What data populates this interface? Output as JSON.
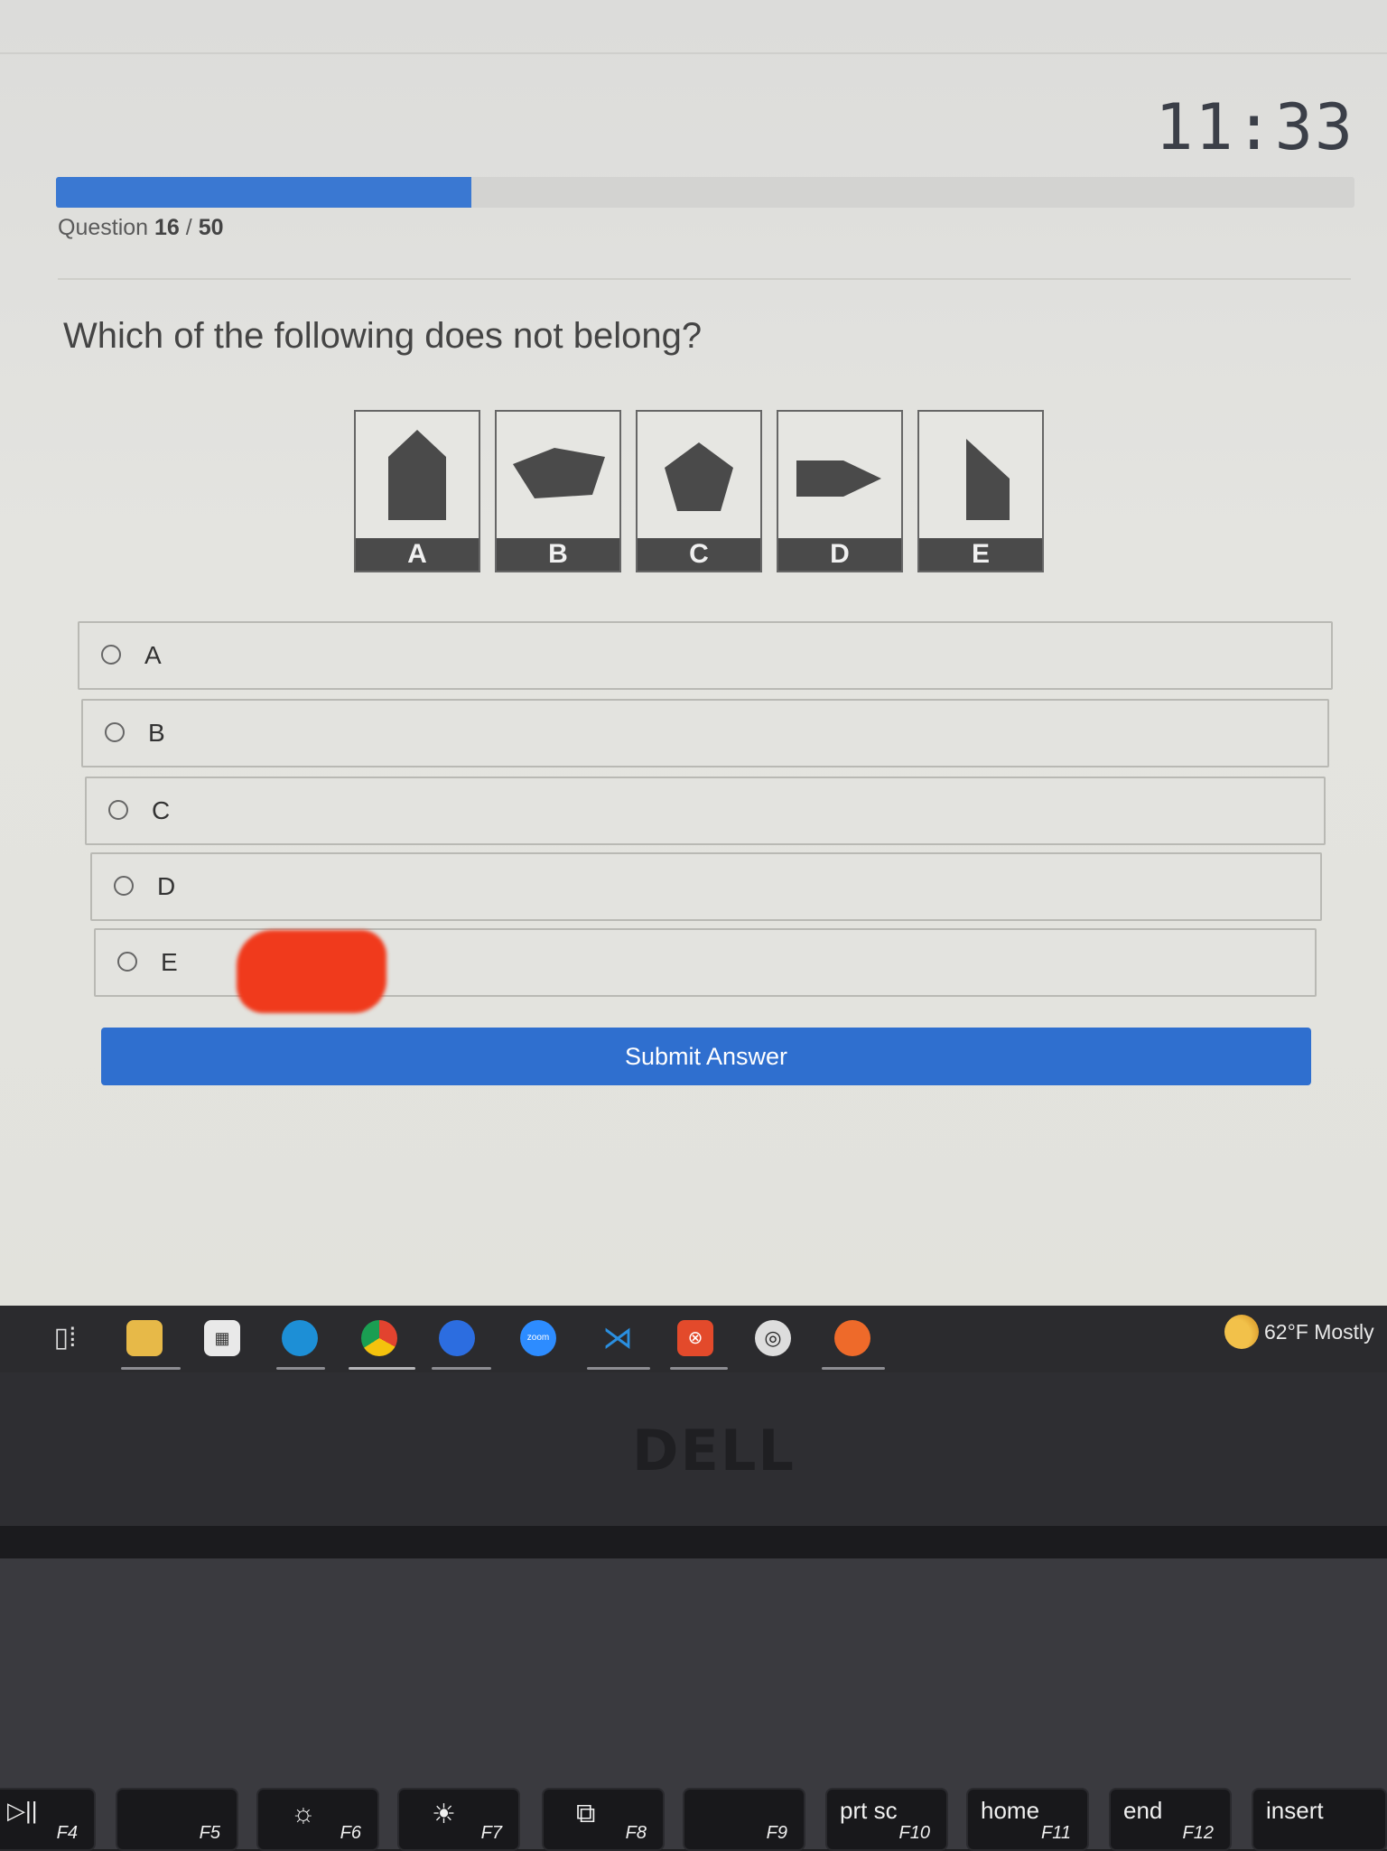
{
  "timer": "11:33",
  "progress": {
    "current": 16,
    "total": 50,
    "fraction": 0.32
  },
  "question_counter": {
    "prefix": "Question",
    "current": "16",
    "sep": "/",
    "total": "50"
  },
  "question": "Which of the following does not belong?",
  "figures": [
    {
      "label": "A",
      "shape": "house-pentagon-icon"
    },
    {
      "label": "B",
      "shape": "flat-pentagon-icon"
    },
    {
      "label": "C",
      "shape": "regular-pentagon-icon"
    },
    {
      "label": "D",
      "shape": "arrow-pentagon-icon"
    },
    {
      "label": "E",
      "shape": "slanted-pentagon-icon"
    }
  ],
  "options": [
    "A",
    "B",
    "C",
    "D",
    "E"
  ],
  "submit_label": "Submit Answer",
  "taskbar": {
    "apps": [
      "task-view-icon",
      "file-explorer-icon",
      "store-icon",
      "edge-icon",
      "chrome-icon",
      "messenger-icon",
      "zoom-icon",
      "vscode-icon",
      "app-icon",
      "obs-icon",
      "app-orange-icon"
    ],
    "zoom_text": "zoom",
    "weather": "62°F  Mostly"
  },
  "brand": "DELL",
  "keys": [
    {
      "main": "▷||",
      "fn": "F4"
    },
    {
      "main": "",
      "fn": "F5"
    },
    {
      "main": "☼",
      "fn": "F6"
    },
    {
      "main": "☀",
      "fn": "F7"
    },
    {
      "main": "⧉",
      "fn": "F8"
    },
    {
      "main": "",
      "fn": "F9"
    },
    {
      "main": "prt sc",
      "fn": "F10"
    },
    {
      "main": "home",
      "fn": "F11"
    },
    {
      "main": "end",
      "fn": "F12"
    },
    {
      "main": "insert",
      "fn": ""
    }
  ]
}
